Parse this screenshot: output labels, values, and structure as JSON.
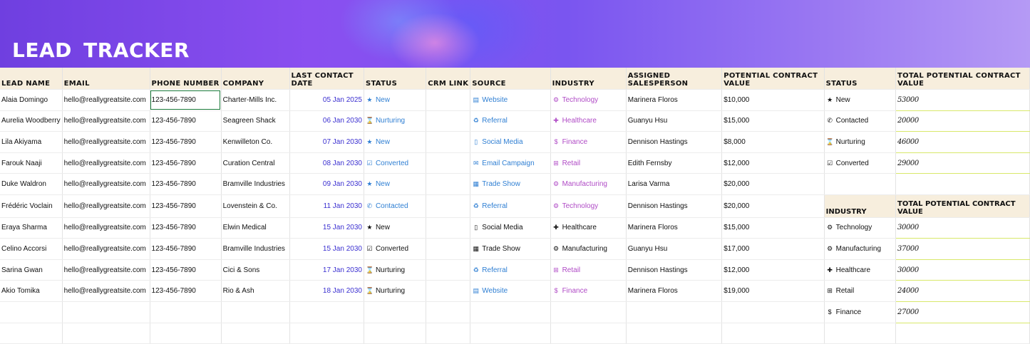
{
  "header": {
    "title": "LEAD TRACKER"
  },
  "columns": [
    "LEAD NAME",
    "EMAIL",
    "PHONE NUMBER",
    "COMPANY",
    "LAST CONTACT DATE",
    "STATUS",
    "CRM LINK",
    "SOURCE",
    "INDUSTRY",
    "ASSIGNED SALESPERSON",
    "POTENTIAL CONTRACT VALUE"
  ],
  "rows": [
    {
      "name": "Alaia Domingo",
      "email": "hello@reallygreatsite.com",
      "phone": "123-456-7890",
      "company": "Charter-Mills Inc.",
      "date": "05 Jan 2025",
      "status": "New",
      "status_icon": "star-icon",
      "status_color": "blue",
      "source": "Website",
      "source_icon": "website-icon",
      "source_color": "blue",
      "industry": "Technology",
      "industry_icon": "technology-icon",
      "industry_color": "purple",
      "salesperson": "Marinera Floros",
      "value": "$10,000"
    },
    {
      "name": "Aurelia Woodberry",
      "email": "hello@reallygreatsite.com",
      "phone": "123-456-7890",
      "company": "Seagreen Shack",
      "date": "06 Jan 2030",
      "status": "Nurturing",
      "status_icon": "hourglass-icon",
      "status_color": "blue",
      "source": "Referral",
      "source_icon": "referral-icon",
      "source_color": "blue",
      "industry": "Healthcare",
      "industry_icon": "healthcare-icon",
      "industry_color": "purple",
      "salesperson": "Guanyu Hsu",
      "value": "$15,000"
    },
    {
      "name": "Lila Akiyama",
      "email": "hello@reallygreatsite.com",
      "phone": "123-456-7890",
      "company": "Kenwilleton Co.",
      "date": "07 Jan 2030",
      "status": "New",
      "status_icon": "star-icon",
      "status_color": "blue",
      "source": "Social Media",
      "source_icon": "phone-device-icon",
      "source_color": "blue",
      "industry": "Finance",
      "industry_icon": "dollar-icon",
      "industry_color": "purple",
      "salesperson": "Dennison Hastings",
      "value": "$8,000"
    },
    {
      "name": "Farouk Naaji",
      "email": "hello@reallygreatsite.com",
      "phone": "123-456-7890",
      "company": "Curation Central",
      "date": "08 Jan 2030",
      "status": "Converted",
      "status_icon": "checkbox-icon",
      "status_color": "blue",
      "source": "Email Campaign",
      "source_icon": "email-icon",
      "source_color": "blue",
      "industry": "Retail",
      "industry_icon": "cart-icon",
      "industry_color": "purple",
      "salesperson": "Edith Fernsby",
      "value": "$12,000"
    },
    {
      "name": "Duke Waldron",
      "email": "hello@reallygreatsite.com",
      "phone": "123-456-7890",
      "company": "Bramville Industries",
      "date": "09 Jan 2030",
      "status": "New",
      "status_icon": "star-icon",
      "status_color": "blue",
      "source": "Trade Show",
      "source_icon": "booth-icon",
      "source_color": "blue",
      "industry": "Manufacturing",
      "industry_icon": "gears-icon",
      "industry_color": "purple",
      "salesperson": "Larisa Varma",
      "value": "$20,000"
    },
    {
      "name": "Frédéric Voclain",
      "email": "hello@reallygreatsite.com",
      "phone": "123-456-7890",
      "company": "Lovenstein & Co.",
      "date": "11 Jan 2030",
      "status": "Contacted",
      "status_icon": "phone-icon",
      "status_color": "blue",
      "source": "Referral",
      "source_icon": "referral-icon",
      "source_color": "blue",
      "industry": "Technology",
      "industry_icon": "technology-icon",
      "industry_color": "purple",
      "salesperson": "Dennison Hastings",
      "value": "$20,000"
    },
    {
      "name": "Eraya Sharma",
      "email": "hello@reallygreatsite.com",
      "phone": "123-456-7890",
      "company": "Elwin Medical",
      "date": "15 Jan 2030",
      "status": "New",
      "status_icon": "star-icon",
      "status_color": "black",
      "source": "Social Media",
      "source_icon": "phone-device-icon",
      "source_color": "black",
      "industry": "Healthcare",
      "industry_icon": "healthcare-icon",
      "industry_color": "black",
      "salesperson": "Marinera Floros",
      "value": "$15,000"
    },
    {
      "name": "Celino Accorsi",
      "email": "hello@reallygreatsite.com",
      "phone": "123-456-7890",
      "company": "Bramville Industries",
      "date": "15 Jan 2030",
      "status": "Converted",
      "status_icon": "checkbox-icon",
      "status_color": "black",
      "source": "Trade Show",
      "source_icon": "booth-icon",
      "source_color": "black",
      "industry": "Manufacturing",
      "industry_icon": "gears-icon",
      "industry_color": "black",
      "salesperson": "Guanyu Hsu",
      "value": "$17,000"
    },
    {
      "name": "Sarina Gwan",
      "email": "hello@reallygreatsite.com",
      "phone": "123-456-7890",
      "company": "Cici & Sons",
      "date": "17 Jan 2030",
      "status": "Nurturing",
      "status_icon": "hourglass-icon",
      "status_color": "black",
      "source": "Referral",
      "source_icon": "referral-icon",
      "source_color": "blue",
      "industry": "Retail",
      "industry_icon": "cart-icon",
      "industry_color": "purple",
      "salesperson": "Dennison Hastings",
      "value": "$12,000"
    },
    {
      "name": "Akio Tomika",
      "email": "hello@reallygreatsite.com",
      "phone": "123-456-7890",
      "company": "Rio & Ash",
      "date": "18 Jan 2030",
      "status": "Nurturing",
      "status_icon": "hourglass-icon",
      "status_color": "black",
      "source": "Website",
      "source_icon": "website-icon",
      "source_color": "blue",
      "industry": "Finance",
      "industry_icon": "dollar-icon",
      "industry_color": "purple",
      "salesperson": "Marinera Floros",
      "value": "$19,000"
    }
  ],
  "status_summary": {
    "header_label": "STATUS",
    "header_value": "TOTAL POTENTIAL CONTRACT VALUE",
    "items": [
      {
        "label": "New",
        "icon": "star-icon",
        "value": "53000"
      },
      {
        "label": "Contacted",
        "icon": "phone-icon",
        "value": "20000"
      },
      {
        "label": "Nurturing",
        "icon": "hourglass-icon",
        "value": "46000"
      },
      {
        "label": "Converted",
        "icon": "checkbox-icon",
        "value": "29000"
      }
    ]
  },
  "industry_summary": {
    "header_label": "INDUSTRY",
    "header_value": "TOTAL POTENTIAL CONTRACT VALUE",
    "items": [
      {
        "label": "Technology",
        "icon": "technology-icon",
        "value": "30000"
      },
      {
        "label": "Manufacturing",
        "icon": "gears-icon",
        "value": "37000"
      },
      {
        "label": "Healthcare",
        "icon": "healthcare-icon",
        "value": "30000"
      },
      {
        "label": "Retail",
        "icon": "cart-icon",
        "value": "24000"
      },
      {
        "label": "Finance",
        "icon": "dollar-icon",
        "value": "27000"
      }
    ]
  },
  "selected_cell": "phone-row-1"
}
